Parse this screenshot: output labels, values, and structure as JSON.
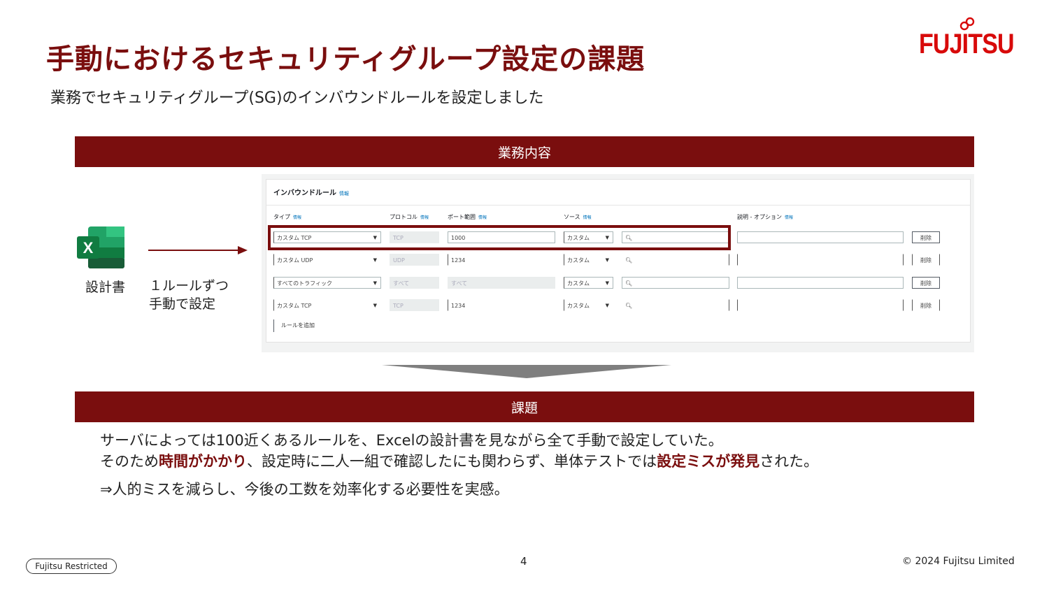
{
  "title": "手動におけるセキュリティグループ設定の課題",
  "logo": {
    "text": "FUJITSU",
    "color": "#d80a0a"
  },
  "subtitle": "業務でセキュリティグループ(SG)のインバウンドルールを設定しました",
  "sections": {
    "business": "業務内容",
    "issue": "課題"
  },
  "diagram": {
    "excel_icon": "excel-icon",
    "design_doc_label": "設計書",
    "step_line1": "１ルールずつ",
    "step_line2": "手動で設定"
  },
  "console": {
    "heading": "インバウンドルール",
    "info": "情報",
    "columns": {
      "type": "タイプ",
      "protocol": "プロトコル",
      "port": "ポート範囲",
      "source": "ソース",
      "description": "説明 - オプション"
    },
    "rows": [
      {
        "type": "カスタム TCP",
        "protocol": "TCP",
        "port": "1000",
        "source": "カスタム",
        "delete": "削除"
      },
      {
        "type": "カスタム UDP",
        "protocol": "UDP",
        "port": "1234",
        "source": "カスタム",
        "delete": "削除"
      },
      {
        "type": "すべてのトラフィック",
        "protocol": "すべて",
        "port": "すべて",
        "source": "カスタム",
        "delete": "削除"
      },
      {
        "type": "カスタム TCP",
        "protocol": "TCP",
        "port": "1234",
        "source": "カスタム",
        "delete": "削除"
      }
    ],
    "add_rule": "ルールを追加"
  },
  "issue_text": {
    "line1": "サーバによっては100近くあるルールを、Excelの設計書を見ながら全て手動で設定していた。",
    "line2_a": "そのため",
    "line2_em1": "時間がかかり",
    "line2_b": "、設定時に二人一組で確認したにも関わらず、単体テストでは",
    "line2_em2": "設定ミスが発見",
    "line2_c": "された。",
    "line3": "⇒人的ミスを減らし、今後の工数を効率化する必要性を実感。"
  },
  "footer": {
    "classification": "Fujitsu Restricted",
    "page": "4",
    "copyright": "© 2024 Fujitsu Limited"
  },
  "colors": {
    "accent": "#7a0e0e"
  }
}
